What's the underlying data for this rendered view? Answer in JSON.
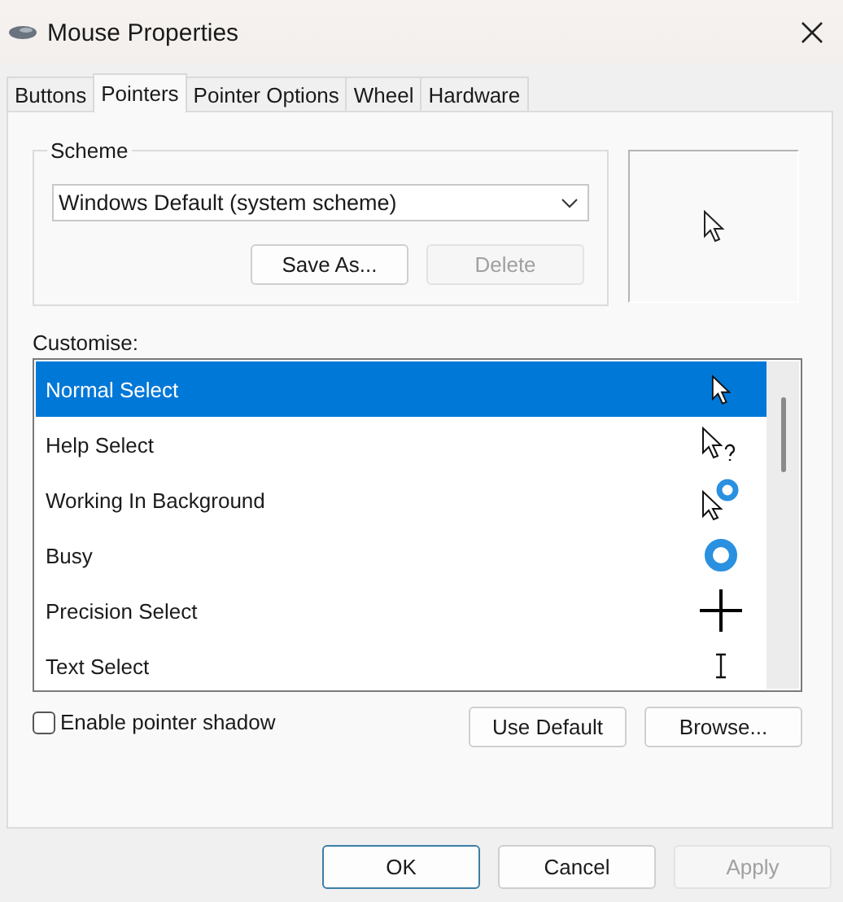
{
  "window": {
    "title": "Mouse Properties"
  },
  "tabs": [
    {
      "label": "Buttons",
      "selected": false
    },
    {
      "label": "Pointers",
      "selected": true
    },
    {
      "label": "Pointer Options",
      "selected": false
    },
    {
      "label": "Wheel",
      "selected": false
    },
    {
      "label": "Hardware",
      "selected": false
    }
  ],
  "scheme": {
    "label": "Scheme",
    "value": "Windows Default (system scheme)",
    "buttons": [
      {
        "label": "Save As...",
        "disabled": false
      },
      {
        "label": "Delete",
        "disabled": true
      }
    ]
  },
  "customise": {
    "label": "Customise:",
    "rows": [
      {
        "name": "Normal Select",
        "kind": "arrow",
        "selected": true
      },
      {
        "name": "Help Select",
        "kind": "help",
        "selected": false
      },
      {
        "name": "Working In Background",
        "kind": "working",
        "selected": false
      },
      {
        "name": "Busy",
        "kind": "busy",
        "selected": false
      },
      {
        "name": "Precision Select",
        "kind": "cross",
        "selected": false
      },
      {
        "name": "Text Select",
        "kind": "text",
        "selected": false
      }
    ]
  },
  "shadow": {
    "label": "Enable pointer shadow",
    "checked": false
  },
  "list_buttons": [
    {
      "label": "Use Default",
      "disabled": false
    },
    {
      "label": "Browse...",
      "disabled": false
    }
  ],
  "dialog_buttons": [
    {
      "label": "OK",
      "disabled": false,
      "default": true
    },
    {
      "label": "Cancel",
      "disabled": false,
      "default": false
    },
    {
      "label": "Apply",
      "disabled": true,
      "default": false
    }
  ]
}
